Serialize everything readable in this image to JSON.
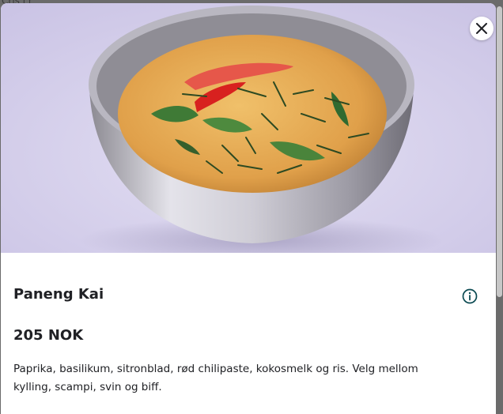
{
  "background": {
    "partial_text": "Cris i r"
  },
  "dish": {
    "name": "Paneng Kai",
    "price": "205 NOK",
    "description": "Paprika, basilikum, sitronblad, rød chilipaste, kokosmelk og ris. Velg mellom kylling, scampi, svin og biff."
  },
  "icons": {
    "close": "close-icon",
    "info": "info-icon"
  },
  "colors": {
    "text": "#202125",
    "accent": "#0b4a52",
    "hero_background": "#d6d0ec",
    "curry": "#e0a64c"
  }
}
